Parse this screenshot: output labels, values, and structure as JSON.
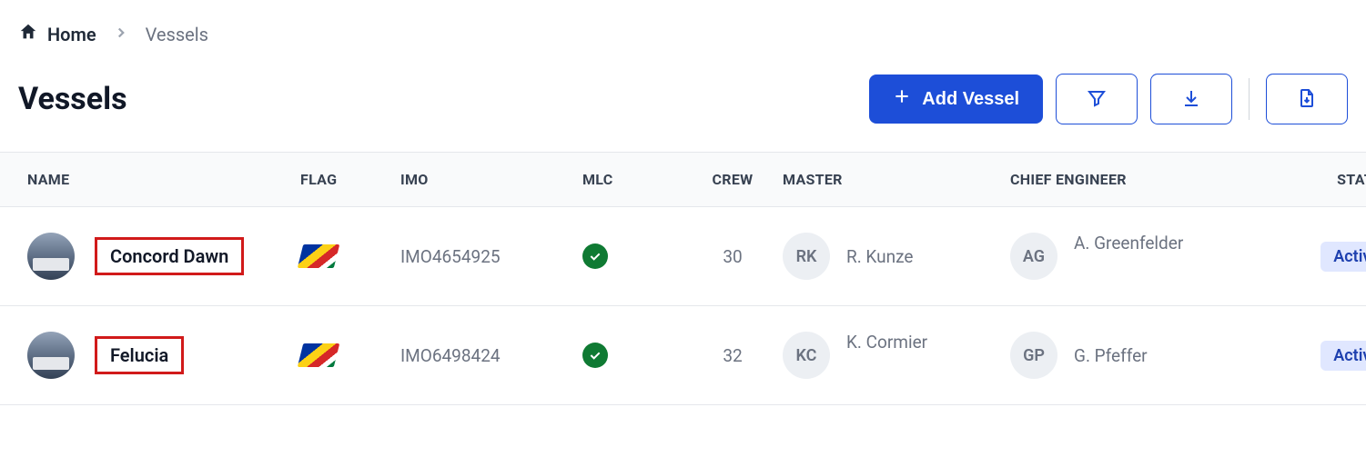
{
  "breadcrumb": {
    "home": "Home",
    "current": "Vessels"
  },
  "page": {
    "title": "Vessels"
  },
  "actions": {
    "add_label": "Add Vessel"
  },
  "columns": {
    "name": "NAME",
    "flag": "FLAG",
    "imo": "IMO",
    "mlc": "MLC",
    "crew": "CREW",
    "master": "MASTER",
    "chief": "CHIEF ENGINEER",
    "status": "STATUS"
  },
  "rows": [
    {
      "name": "Concord Dawn",
      "imo": "IMO4654925",
      "crew": "30",
      "master_initials": "RK",
      "master_name": "R. Kunze",
      "chief_initials": "AG",
      "chief_name": "A. Greenfelder",
      "status": "Active"
    },
    {
      "name": "Felucia",
      "imo": "IMO6498424",
      "crew": "32",
      "master_initials": "KC",
      "master_name": "K. Cormier",
      "chief_initials": "GP",
      "chief_name": "G. Pfeffer",
      "status": "Active"
    }
  ]
}
